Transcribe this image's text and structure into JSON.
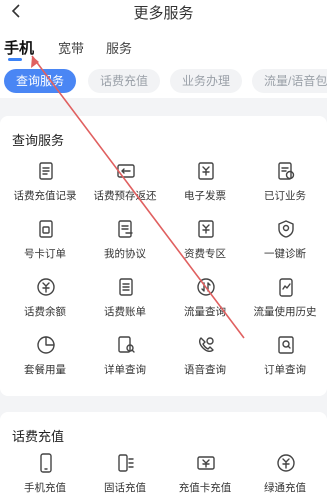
{
  "header": {
    "title": "更多服务"
  },
  "tabs": [
    "手机",
    "宽带",
    "服务"
  ],
  "chips": [
    "查询服务",
    "话费充值",
    "业务办理",
    "流量/语音包"
  ],
  "sections": [
    {
      "title": "查询服务",
      "items": [
        {
          "label": "话费充值记录",
          "icon": "receipt-icon"
        },
        {
          "label": "话费预存返还",
          "icon": "money-return-icon"
        },
        {
          "label": "电子发票",
          "icon": "invoice-icon"
        },
        {
          "label": "已订业务",
          "icon": "subscribed-icon"
        },
        {
          "label": "号卡订单",
          "icon": "sim-order-icon"
        },
        {
          "label": "我的协议",
          "icon": "agreement-icon"
        },
        {
          "label": "资费专区",
          "icon": "tariff-icon"
        },
        {
          "label": "一键诊断",
          "icon": "diagnose-icon"
        },
        {
          "label": "话费余额",
          "icon": "balance-icon"
        },
        {
          "label": "话费账单",
          "icon": "bill-icon"
        },
        {
          "label": "流量查询",
          "icon": "data-query-icon"
        },
        {
          "label": "流量使用历史",
          "icon": "data-history-icon"
        },
        {
          "label": "套餐用量",
          "icon": "pie-icon"
        },
        {
          "label": "详单查询",
          "icon": "detail-search-icon"
        },
        {
          "label": "语音查询",
          "icon": "voice-query-icon"
        },
        {
          "label": "订单查询",
          "icon": "order-search-icon"
        }
      ]
    },
    {
      "title": "话费充值",
      "items": [
        {
          "label": "手机充值",
          "icon": "phone-icon"
        },
        {
          "label": "固话充值",
          "icon": "landline-icon"
        },
        {
          "label": "充值卡充值",
          "icon": "card-topup-icon"
        },
        {
          "label": "绿通充值",
          "icon": "green-topup-icon"
        }
      ]
    }
  ],
  "colors": {
    "accent": "#4a86f4",
    "annotation": "#e06060"
  }
}
